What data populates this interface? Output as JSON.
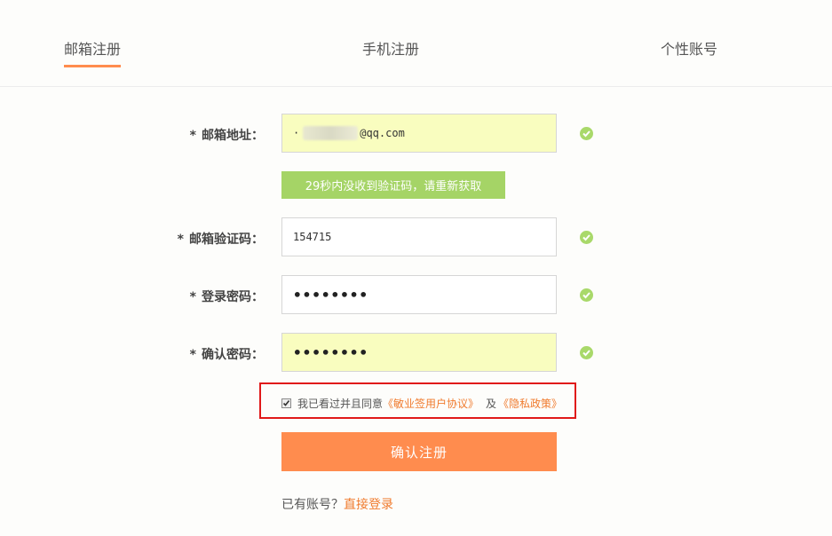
{
  "tabs": [
    {
      "label": "邮箱注册",
      "active": true
    },
    {
      "label": "手机注册",
      "active": false
    },
    {
      "label": "个性账号",
      "active": false
    }
  ],
  "form": {
    "email": {
      "label": "邮箱地址：",
      "required_mark": "*",
      "value_prefix": "·",
      "value_suffix": "@qq.com",
      "valid": true
    },
    "resend_label": "29秒内没收到验证码，请重新获取",
    "code": {
      "label": "邮箱验证码：",
      "required_mark": "*",
      "value": "154715",
      "valid": true
    },
    "password": {
      "label": "登录密码：",
      "required_mark": "*",
      "value": "••••••••",
      "valid": true
    },
    "confirm": {
      "label": "确认密码：",
      "required_mark": "*",
      "value": "••••••••",
      "valid": true
    }
  },
  "agreement": {
    "checked": true,
    "text": "我已看过并且同意",
    "terms_link": "《敏业签用户协议》",
    "and": "及",
    "privacy_link": "《隐私政策》"
  },
  "submit_label": "确认注册",
  "login": {
    "prompt": "已有账号？",
    "link": "直接登录"
  },
  "colors": {
    "accent": "#ff8c4e",
    "success": "#a9d96a",
    "resend_bg": "#a5d466",
    "field_filled": "#f9fdbf",
    "highlight_border": "#e01919"
  }
}
